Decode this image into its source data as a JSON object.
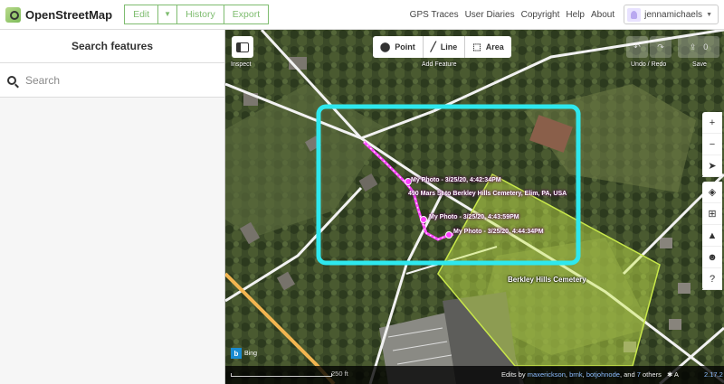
{
  "header": {
    "brand": "OpenStreetMap",
    "edit_label": "Edit",
    "edit_caret": "▼",
    "history_label": "History",
    "export_label": "Export",
    "nav": [
      "GPS Traces",
      "User Diaries",
      "Copyright",
      "Help",
      "About"
    ],
    "username": "jennamichaels"
  },
  "sidebar": {
    "title": "Search features",
    "search_placeholder": "Search"
  },
  "map": {
    "toolbar": {
      "inspect_label": "Inspect",
      "add_feature_label": "Add Feature",
      "point_label": "Point",
      "line_label": "Line",
      "area_label": "Area",
      "undo_redo_label": "Undo / Redo",
      "save_label": "Save",
      "save_count": "0"
    },
    "labels": {
      "photo1": "My Photo - 3/25/20, 4:42:34PM",
      "street": "490 Mars St to Berkley Hills Cemetery, Elim, PA, USA",
      "photo2": "My Photo - 3/25/20, 4:43:59PM",
      "photo3": "My Photo - 3/25/20, 4:44:34PM",
      "cemetery": "Berkley Hills Cemetery"
    },
    "imagery": "Bing",
    "scale_label": "250 ft",
    "attribution": {
      "prefix": "Edits by",
      "editor1": "maxerickson",
      "editor2": "brnk",
      "editor3": "botjohnode",
      "middle": ", and",
      "others_count": "7",
      "suffix": "others"
    },
    "version": "2.17.2",
    "highlight_color": "#2ee8ee",
    "route_color": "#ff40ff",
    "cemetery_fill": "#c8e84a"
  }
}
